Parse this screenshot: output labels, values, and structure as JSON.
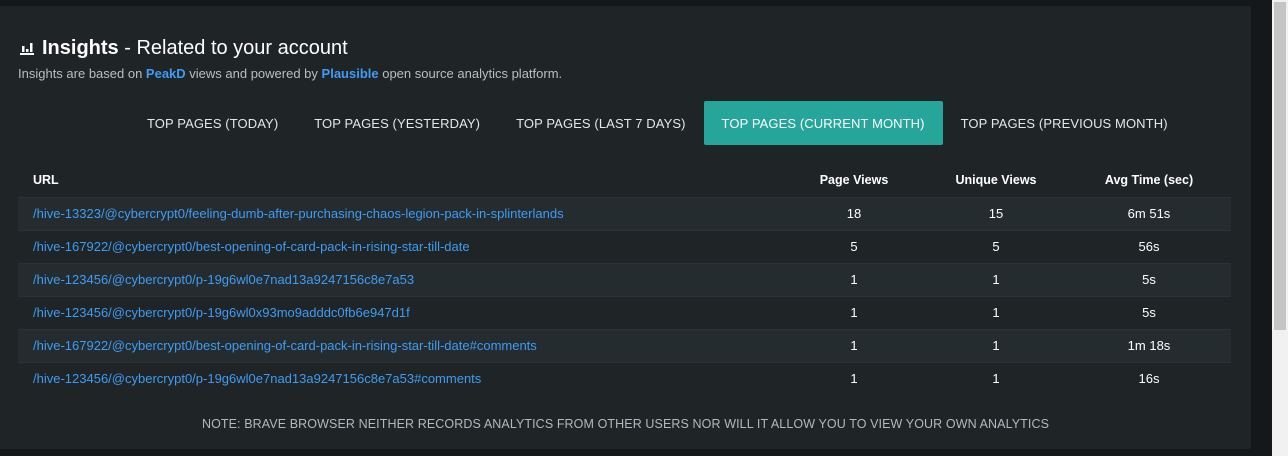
{
  "header": {
    "icon": "bar-chart-icon",
    "title_bold": "Insights",
    "title_rest": " - Related to your account",
    "subtitle_pre": "Insights are based on ",
    "subtitle_link1": "PeakD",
    "subtitle_mid": " views and powered by ",
    "subtitle_link2": "Plausible",
    "subtitle_post": " open source analytics platform."
  },
  "tabs": [
    {
      "label": "TOP PAGES (TODAY)",
      "active": false
    },
    {
      "label": "TOP PAGES (YESTERDAY)",
      "active": false
    },
    {
      "label": "TOP PAGES (LAST 7 DAYS)",
      "active": false
    },
    {
      "label": "TOP PAGES (CURRENT MONTH)",
      "active": true
    },
    {
      "label": "TOP PAGES (PREVIOUS MONTH)",
      "active": false
    }
  ],
  "table": {
    "columns": [
      "URL",
      "Page Views",
      "Unique Views",
      "Avg Time (sec)"
    ],
    "rows": [
      {
        "url": "/hive-13323/@cybercrypt0/feeling-dumb-after-purchasing-chaos-legion-pack-in-splinterlands",
        "views": "18",
        "unique": "15",
        "time": "6m 51s"
      },
      {
        "url": "/hive-167922/@cybercrypt0/best-opening-of-card-pack-in-rising-star-till-date",
        "views": "5",
        "unique": "5",
        "time": "56s"
      },
      {
        "url": "/hive-123456/@cybercrypt0/p-19g6wl0e7nad13a9247156c8e7a53",
        "views": "1",
        "unique": "1",
        "time": "5s"
      },
      {
        "url": "/hive-123456/@cybercrypt0/p-19g6wl0x93mo9adddc0fb6e947d1f",
        "views": "1",
        "unique": "1",
        "time": "5s"
      },
      {
        "url": "/hive-167922/@cybercrypt0/best-opening-of-card-pack-in-rising-star-till-date#comments",
        "views": "1",
        "unique": "1",
        "time": "1m 18s"
      },
      {
        "url": "/hive-123456/@cybercrypt0/p-19g6wl0e7nad13a9247156c8e7a53#comments",
        "views": "1",
        "unique": "1",
        "time": "16s"
      }
    ]
  },
  "note": "NOTE: BRAVE BROWSER NEITHER RECORDS ANALYTICS FROM OTHER USERS NOR WILL IT ALLOW YOU TO VIEW YOUR OWN ANALYTICS",
  "colors": {
    "accent": "#26a69a",
    "link": "#3f9cf2",
    "card": "#1f2426",
    "page": "#15181b"
  }
}
